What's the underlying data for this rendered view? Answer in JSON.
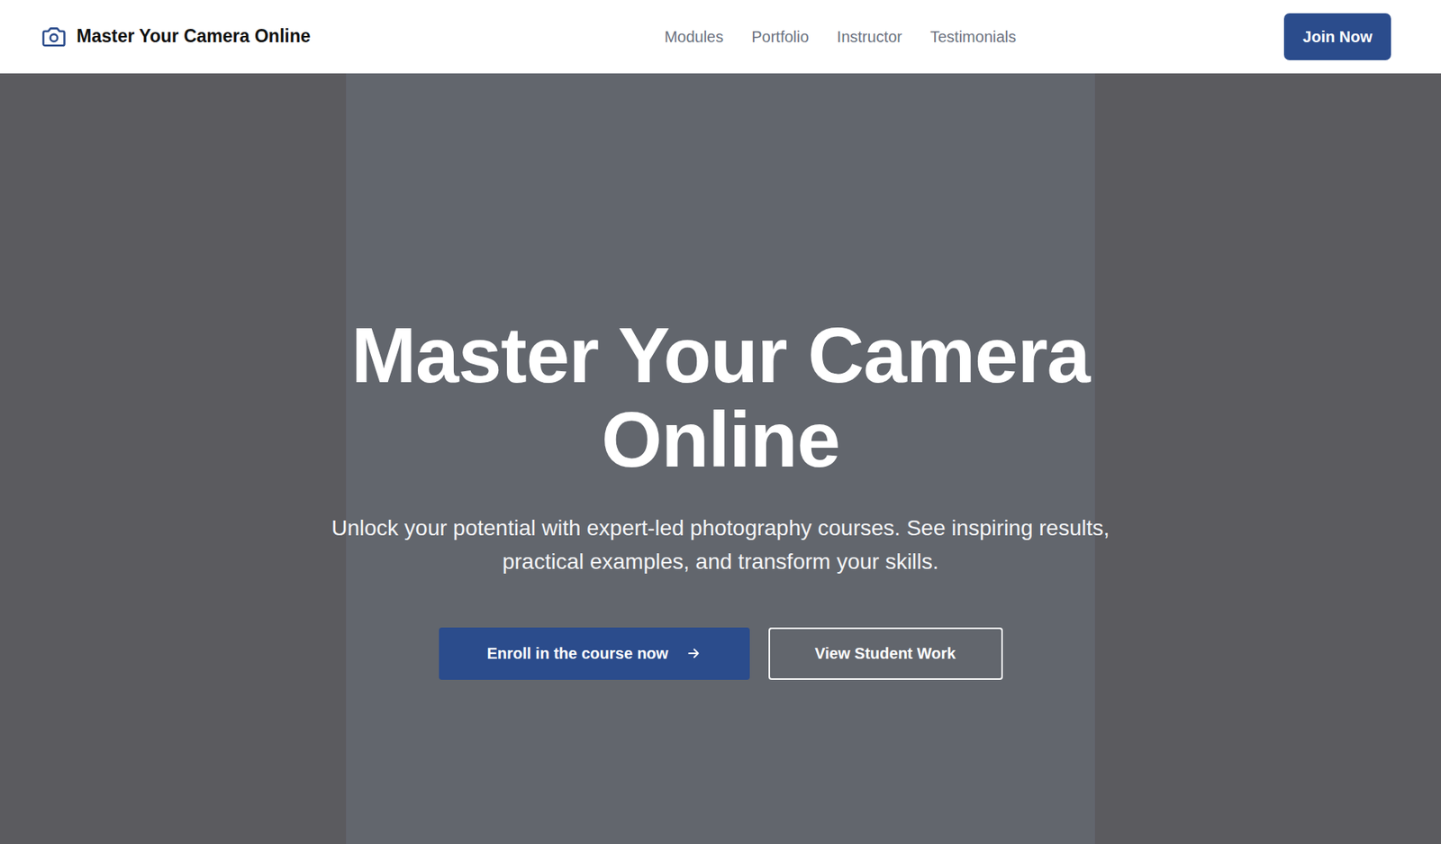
{
  "nav": {
    "brand": "Master Your Camera Online",
    "links": [
      "Modules",
      "Portfolio",
      "Instructor",
      "Testimonials"
    ],
    "cta": "Join Now"
  },
  "hero": {
    "title": "Master Your Camera Online",
    "subtitle": "Unlock your potential with expert-led photography courses. See inspiring results, practical examples, and transform your skills.",
    "primary_button": "Enroll in the course now",
    "secondary_button": "View Student Work"
  }
}
